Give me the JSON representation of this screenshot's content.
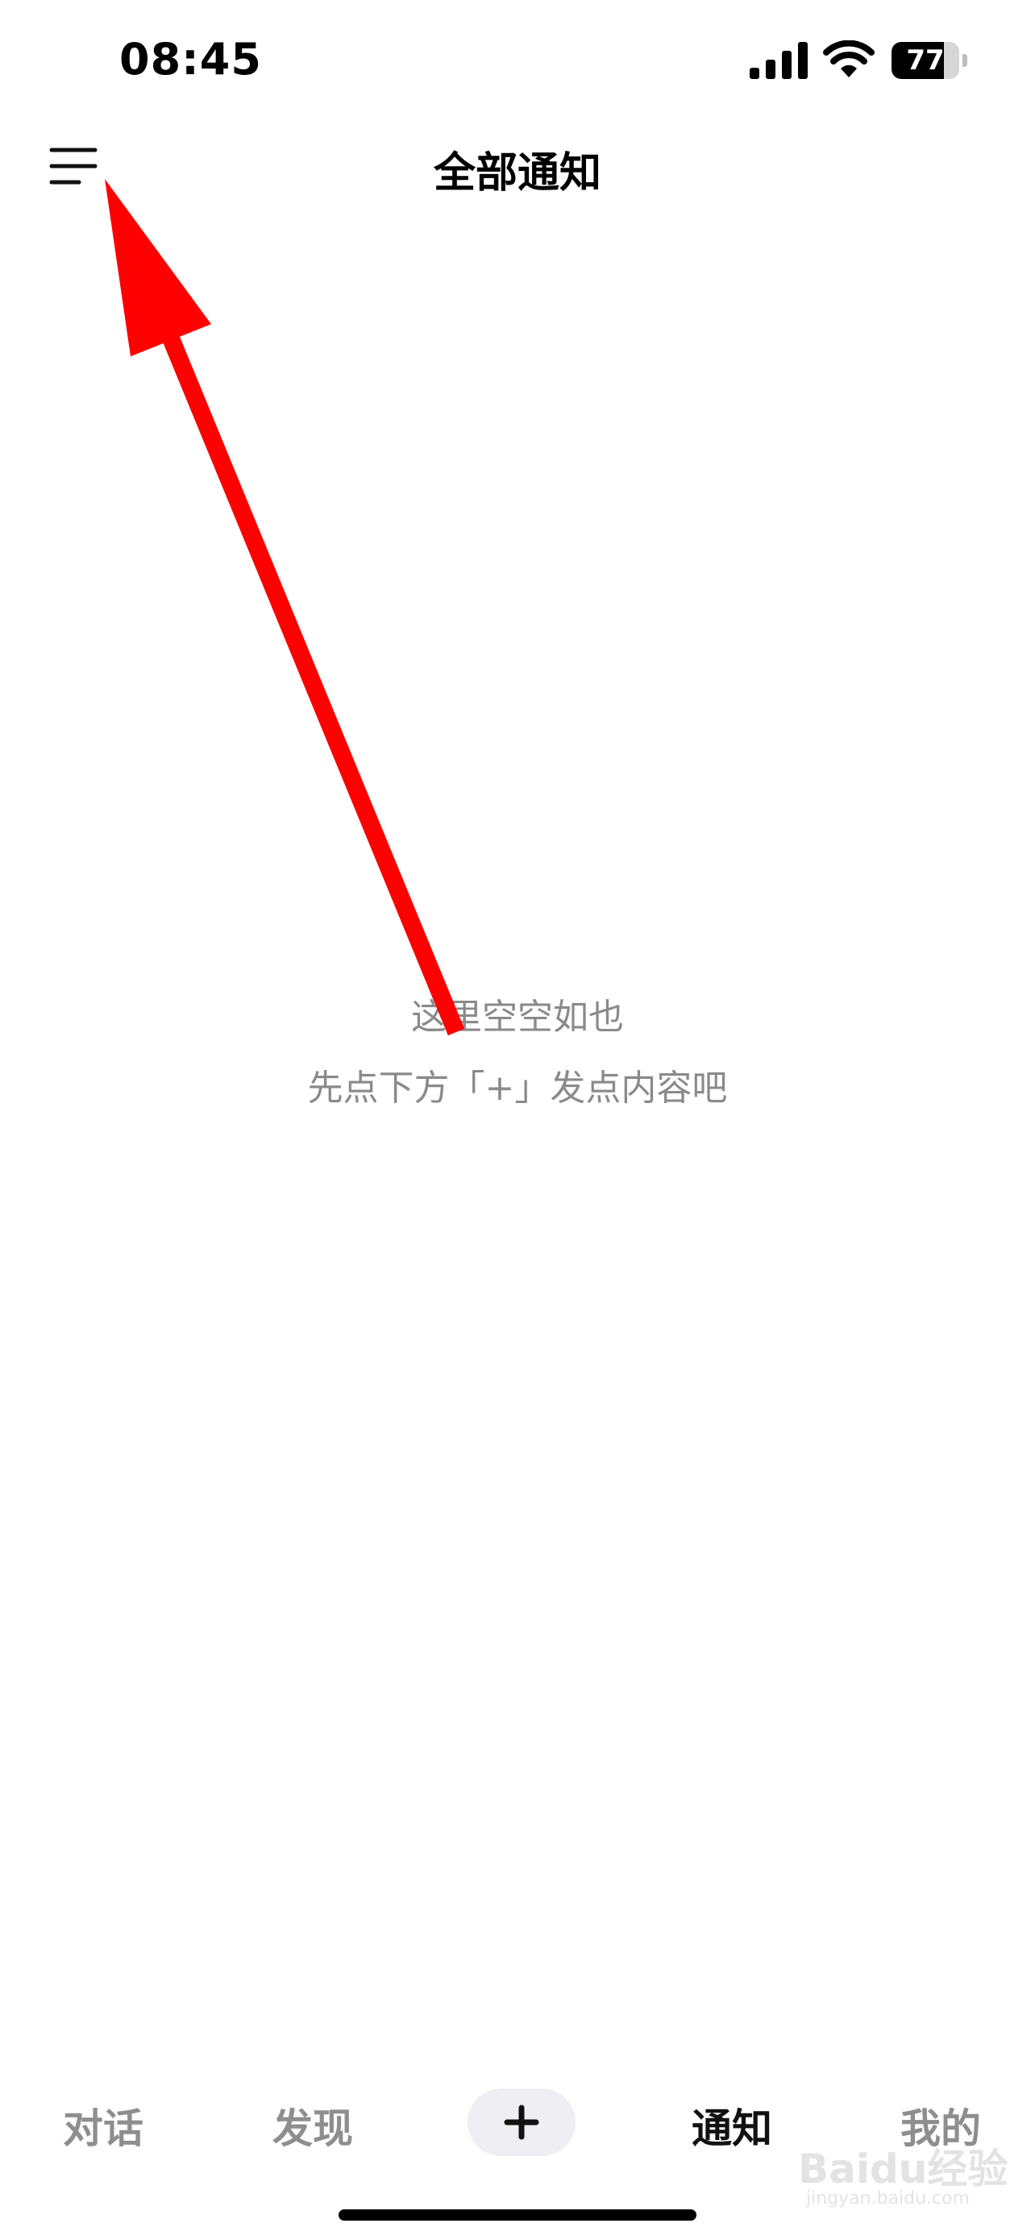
{
  "status_bar": {
    "time": "08:45",
    "battery_level": 77,
    "battery_text": "77",
    "icons": [
      "cellular-signal-icon",
      "wifi-icon",
      "battery-icon"
    ]
  },
  "header": {
    "title": "全部通知",
    "menu_icon": "hamburger-menu-icon"
  },
  "empty_state": {
    "title": "这里空空如也",
    "hint": "先点下方「+」发点内容吧"
  },
  "tab_bar": {
    "tabs": [
      {
        "label": "对话",
        "active": false
      },
      {
        "label": "发现",
        "active": false
      },
      {
        "label": "+",
        "icon": "plus-icon",
        "active": false
      },
      {
        "label": "通知",
        "active": true
      },
      {
        "label": "我的",
        "active": false
      }
    ]
  },
  "annotation": {
    "type": "red-arrow",
    "color": "#ff0000",
    "points_to": "menu-button"
  },
  "watermark": {
    "logo": "Baidu经验",
    "sub": "jingyan.baidu.com"
  },
  "colors": {
    "text_primary": "#111111",
    "text_muted": "#8a8a8a",
    "tab_inactive": "#8e8e8e",
    "add_button_bg": "#efeff3",
    "annotation": "#ff0000"
  }
}
